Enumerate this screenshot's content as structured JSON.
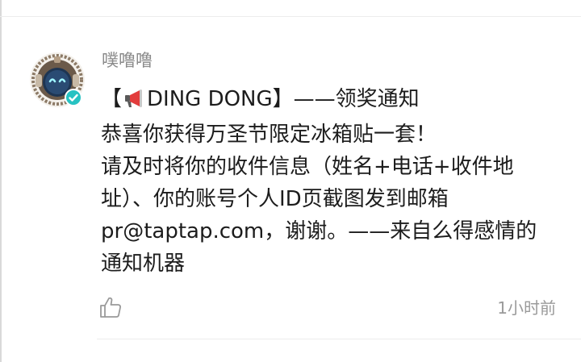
{
  "post": {
    "author": "噗噜噜",
    "lines": [
      {
        "prefix": "【",
        "suffix": "DING DONG】——领奖通知"
      },
      "恭喜你获得万圣节限定冰箱贴一套！",
      "请及时将你的收件信息（姓名+电话+收件地",
      "址）、你的账号个人ID页截图发到邮箱",
      "pr@taptap.com，谢谢。——来自么得感情的",
      "通知机器"
    ],
    "timestamp": "1小时前"
  },
  "icons": {
    "megaphone": "megaphone-icon",
    "like": "thumbs-up-icon",
    "verified": "verified-check-icon"
  },
  "colors": {
    "verified_badge": "#27c2c2",
    "megaphone_red": "#e23c3c",
    "text": "#1c1c1c",
    "muted": "#8a8a8a"
  }
}
